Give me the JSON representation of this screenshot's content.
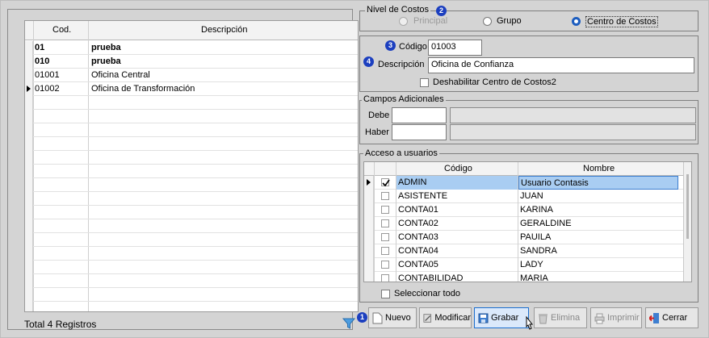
{
  "list": {
    "col_code": "Cod.",
    "col_desc": "Descripción",
    "rows": [
      {
        "code": "01",
        "desc": "prueba",
        "bold": true
      },
      {
        "code": "010",
        "desc": "prueba",
        "bold": true
      },
      {
        "code": "01001",
        "desc": "Oficina Central",
        "bold": false
      },
      {
        "code": "01002",
        "desc": "Oficina de Transformación",
        "bold": false
      }
    ],
    "total": "Total 4 Registros"
  },
  "nivel": {
    "title": "Nivel de Costos",
    "badge": "2",
    "options": [
      "Principal",
      "Grupo",
      "Centro de Costos"
    ],
    "selected": "Centro de Costos"
  },
  "detail": {
    "badge3": "3",
    "badge4": "4",
    "codigo_label": "Código",
    "codigo_value": "01003",
    "descripcion_label": "Descripción",
    "descripcion_value": "Oficina de Confianza",
    "deshabilitar_label": "Deshabilitar Centro de Costos2"
  },
  "campos": {
    "title": "Campos Adicionales",
    "debe_label": "Debe",
    "haber_label": "Haber"
  },
  "acceso": {
    "title": "Acceso a usuarios",
    "col_code": "Código",
    "col_name": "Nombre",
    "users": [
      {
        "code": "ADMIN",
        "name": "Usuario Contasis",
        "checked": true
      },
      {
        "code": "ASISTENTE",
        "name": "JUAN",
        "checked": false
      },
      {
        "code": "CONTA01",
        "name": "KARINA",
        "checked": false
      },
      {
        "code": "CONTA02",
        "name": "GERALDINE",
        "checked": false
      },
      {
        "code": "CONTA03",
        "name": "PAUILA",
        "checked": false
      },
      {
        "code": "CONTA04",
        "name": "SANDRA",
        "checked": false
      },
      {
        "code": "CONTA05",
        "name": "LADY",
        "checked": false
      },
      {
        "code": "CONTABILIDAD",
        "name": "MARIA",
        "checked": false
      }
    ],
    "select_all_label": "Seleccionar todo"
  },
  "toolbar": {
    "badge1": "1",
    "nuevo": "Nuevo",
    "modificar": "Modificar",
    "grabar": "Grabar",
    "elimina": "Elimina",
    "imprimir": "Imprimir",
    "cerrar": "Cerrar"
  },
  "colors": {
    "accent": "#1c5dbf",
    "selection": "#a9cdf2"
  }
}
